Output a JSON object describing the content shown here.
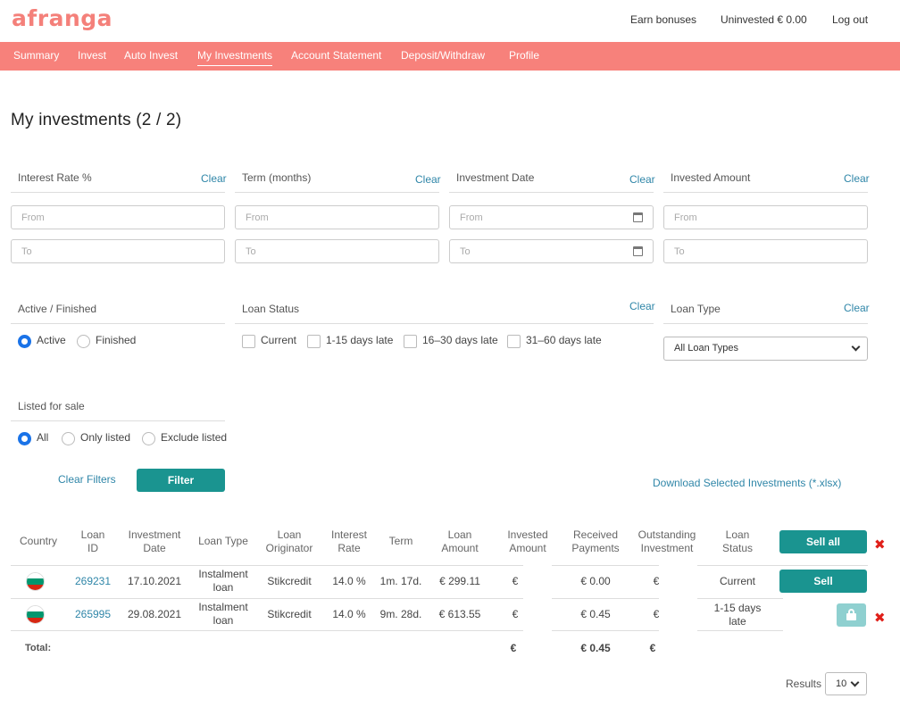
{
  "header": {
    "logo": "afranga",
    "earn_bonuses": "Earn bonuses",
    "uninvested": "Uninvested € 0.00",
    "logout": "Log out"
  },
  "nav": [
    "Summary",
    "Invest",
    "Auto Invest",
    "My Investments",
    "Account Statement",
    "Deposit/Withdraw",
    "Profile"
  ],
  "nav_active": "My Investments",
  "page_title": "My investments  (2 / 2)",
  "filters": {
    "clear": "Clear",
    "interest_rate": {
      "label": "Interest Rate %",
      "from": "From",
      "to": "To"
    },
    "term": {
      "label": "Term (months)",
      "from": "From",
      "to": "To"
    },
    "investment_date": {
      "label": "Investment Date",
      "from": "From",
      "to": "To"
    },
    "invested_amount": {
      "label": "Invested Amount",
      "from": "From",
      "to": "To"
    },
    "active_finished": {
      "label": "Active / Finished",
      "options": [
        "Active",
        "Finished"
      ],
      "selected": "Active"
    },
    "loan_status": {
      "label": "Loan Status",
      "options": [
        "Current",
        "1-15 days late",
        "16–30 days late",
        "31–60 days late"
      ]
    },
    "loan_type": {
      "label": "Loan Type",
      "selected": "All Loan Types"
    },
    "listed_for_sale": {
      "label": "Listed for sale",
      "options": [
        "All",
        "Only listed",
        "Exclude listed"
      ],
      "selected": "All"
    },
    "clear_filters": "Clear Filters",
    "filter_button": "Filter"
  },
  "download_link": "Download Selected Investments (*.xlsx)",
  "table": {
    "headers": [
      "Country",
      "Loan\nID",
      "Investment\nDate",
      "Loan Type",
      "Loan\nOriginator",
      "Interest\nRate",
      "Term",
      "Loan\nAmount",
      "Invested\nAmount",
      "Received\nPayments",
      "Outstanding\nInvestment",
      "Loan\nStatus"
    ],
    "sell_all": "Sell all",
    "sell": "Sell",
    "rows": [
      {
        "loan_id": "269231",
        "date": "17.10.2021",
        "type": "Instalment\nloan",
        "originator": "Stikcredit",
        "rate": "14.0 %",
        "term": "1m. 17d.",
        "amount": "€ 299.11",
        "invested": "€",
        "received": "€ 0.00",
        "outstanding": "€",
        "status": "Current"
      },
      {
        "loan_id": "265995",
        "date": "29.08.2021",
        "type": "Instalment\nloan",
        "originator": "Stikcredit",
        "rate": "14.0 %",
        "term": "9m. 28d.",
        "amount": "€ 613.55",
        "invested": "€",
        "received": "€ 0.45",
        "outstanding": "€",
        "status": "1-15 days\nlate"
      }
    ],
    "total_label": "Total:",
    "total_invested": "€",
    "total_received": "€ 0.45",
    "total_outstanding": "€"
  },
  "results": {
    "label": "Results",
    "value": "10"
  },
  "colors": {
    "brand": "#f7817b",
    "teal": "#1a9490",
    "link": "#2f86a8",
    "danger": "#e0201a"
  }
}
